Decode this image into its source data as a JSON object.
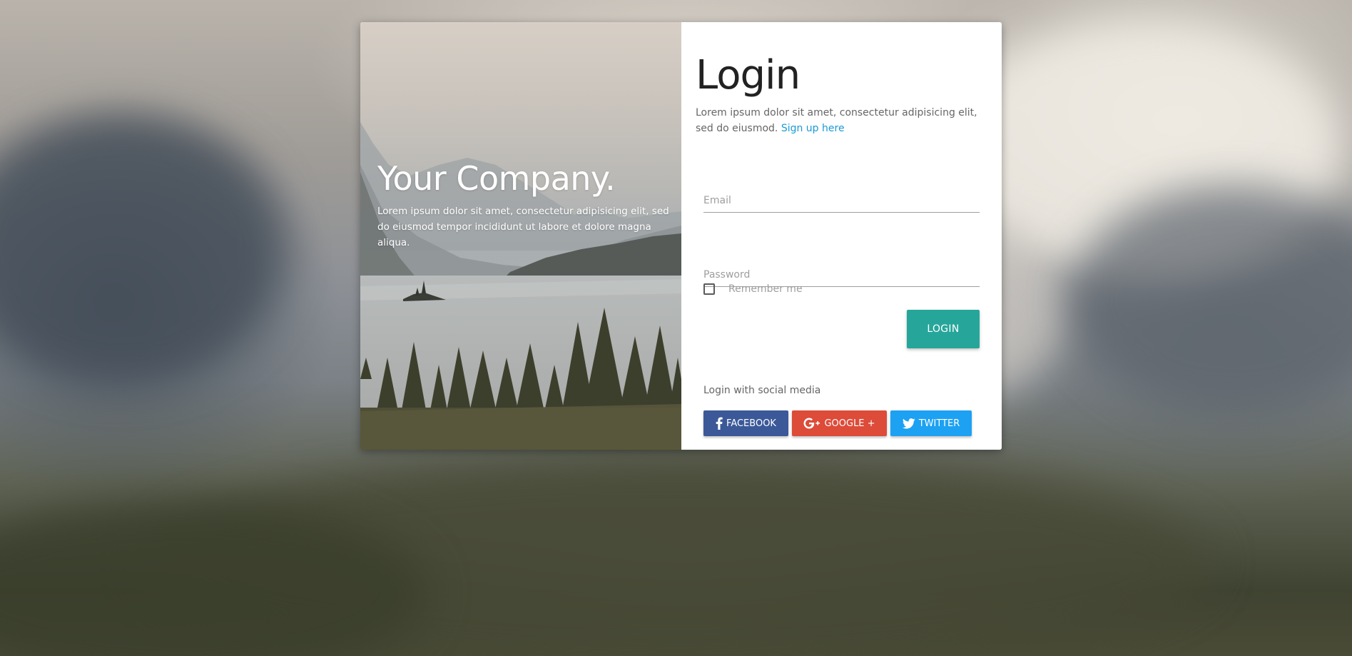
{
  "left_panel": {
    "title": "Your Company.",
    "description": "Lorem ipsum dolor sit amet, consectetur adipisicing elit, sed do eiusmod tempor incididunt ut labore et dolore magna aliqua."
  },
  "login": {
    "title": "Login",
    "description": "Lorem ipsum dolor sit amet, consectetur adipisicing elit, sed do eiusmod.",
    "signup_link": "Sign up here",
    "email_placeholder": "Email",
    "password_placeholder": "Password",
    "remember_label": "Remember me",
    "remember_checked": false,
    "submit_label": "LOGIN"
  },
  "social": {
    "label": "Login with social media",
    "buttons": [
      {
        "label": "FACEBOOK",
        "icon": "facebook-icon",
        "color": "#3b5998"
      },
      {
        "label": "GOOGLE +",
        "icon": "google-plus-icon",
        "color": "#dd4b39"
      },
      {
        "label": "TWITTER",
        "icon": "twitter-icon",
        "color": "#1da1f2"
      }
    ]
  },
  "colors": {
    "primary": "#26a69a",
    "link": "#1a9ad6"
  }
}
